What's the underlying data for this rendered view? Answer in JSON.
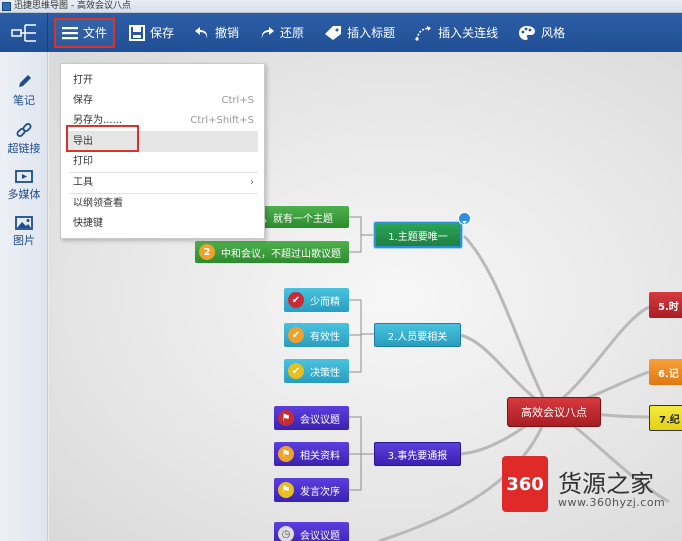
{
  "window": {
    "title": "迅捷思维导图 - 高效会议八点"
  },
  "toolbar": {
    "file": "文件",
    "save": "保存",
    "undo": "撤销",
    "redo": "还原",
    "insert_title": "插入标题",
    "insert_link": "插入关连线",
    "style": "风格"
  },
  "sidebar": {
    "items": [
      {
        "label": "笔记",
        "icon": "pencil-icon"
      },
      {
        "label": "超链接",
        "icon": "link-icon"
      },
      {
        "label": "多媒体",
        "icon": "media-icon"
      },
      {
        "label": "图片",
        "icon": "image-icon"
      }
    ]
  },
  "file_menu": {
    "open": "打开",
    "save": "保存",
    "save_shortcut": "Ctrl+S",
    "save_as": "另存为......",
    "save_as_shortcut": "Ctrl+Shift+S",
    "export": "导出",
    "print": "打印",
    "tools": "工具",
    "tools_arrow": "›",
    "outline_view": "以纲领查看",
    "shortcuts": "快捷键"
  },
  "mindmap": {
    "center": "高效会议八点",
    "branch1": "1.主题要唯一",
    "branch1_sub1": "议，就有一个主题",
    "branch1_sub2": "中和会议，不超过山歌议题",
    "branch1_sub2_num": "2",
    "branch2": "2.人员要相关",
    "branch2_subs": [
      "少而精",
      "有效性",
      "决策性"
    ],
    "branch3": "3.事先要通报",
    "branch3_subs": [
      "会议议题",
      "相关资料",
      "发言次序"
    ],
    "branch4_sub": "会议议题",
    "right1": "5.时",
    "right2": "6.记",
    "right3": "7.纪"
  },
  "watermark": {
    "brand": "360",
    "name": "货源之家",
    "url": "www.360hyzj.com"
  },
  "colors": {
    "toolbar": "#2c5ea6",
    "highlight_red": "#d9342b",
    "green": "#3d9a3d",
    "teal": "#2f9fc0",
    "purple": "#4b2ec8",
    "center": "#c0272d",
    "orange": "#f08a1d",
    "yellow": "#f1e21b"
  }
}
